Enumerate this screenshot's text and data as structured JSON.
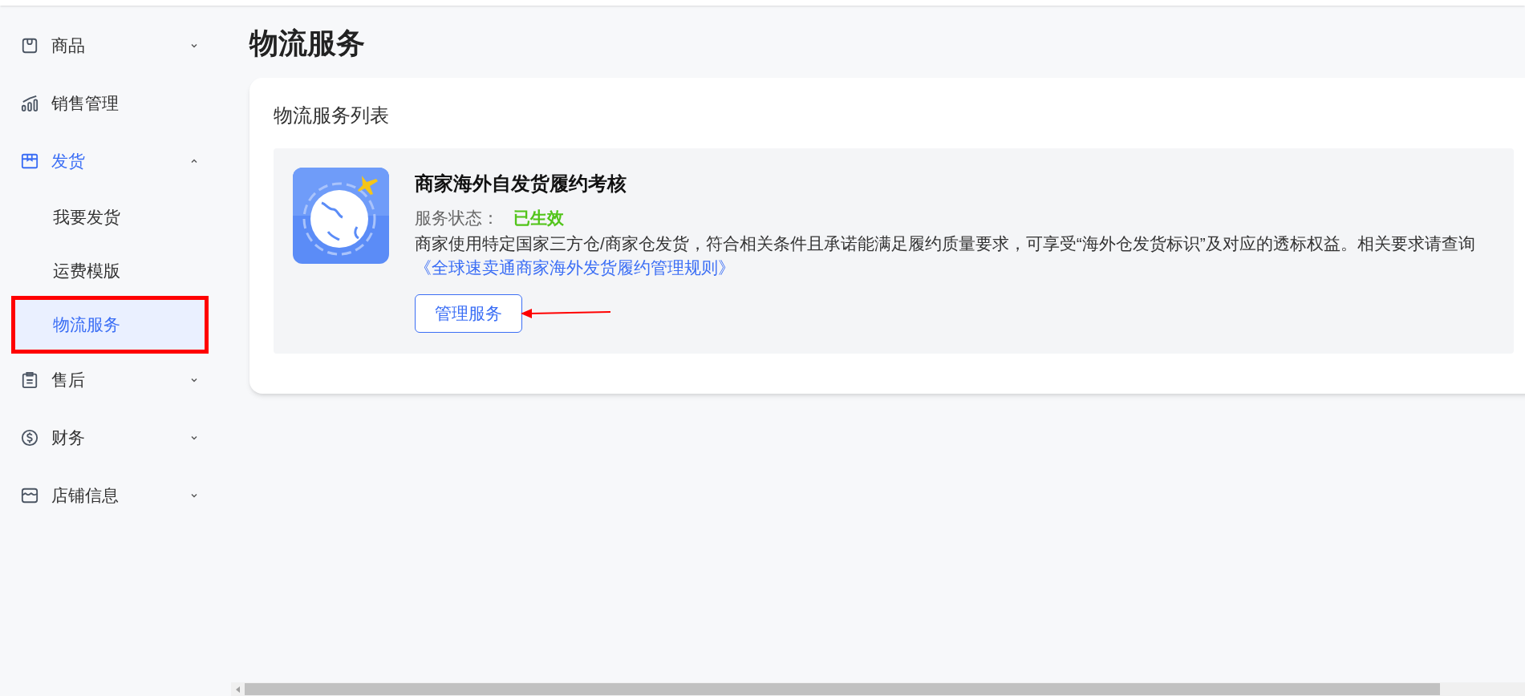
{
  "sidebar": {
    "items": [
      {
        "kind": "group",
        "label": "商品",
        "expanded": false,
        "selected": false
      },
      {
        "kind": "link",
        "label": "销售管理",
        "selected": false
      },
      {
        "kind": "group",
        "label": "发货",
        "expanded": true,
        "selected": true,
        "children": [
          {
            "label": "我要发货",
            "selected": false
          },
          {
            "label": "运费模版",
            "selected": false
          },
          {
            "label": "物流服务",
            "selected": true
          }
        ]
      },
      {
        "kind": "group",
        "label": "售后",
        "expanded": false,
        "selected": false
      },
      {
        "kind": "group",
        "label": "财务",
        "expanded": false,
        "selected": false
      },
      {
        "kind": "group",
        "label": "店铺信息",
        "expanded": false,
        "selected": false
      }
    ]
  },
  "page": {
    "title": "物流服务",
    "card": {
      "title": "物流服务列表",
      "services": [
        {
          "name": "商家海外自发货履约考核",
          "status_label": "服务状态：",
          "status": "已生效",
          "description": "商家使用特定国家三方仓/商家仓发货，符合相关条件且承诺能满足履约质量要求，可享受“海外仓发货标识”及对应的透标权益。相关要求请查询",
          "rule_link": "《全球速卖通商家海外发货履约管理规则》",
          "button": "管理服务"
        }
      ]
    }
  }
}
